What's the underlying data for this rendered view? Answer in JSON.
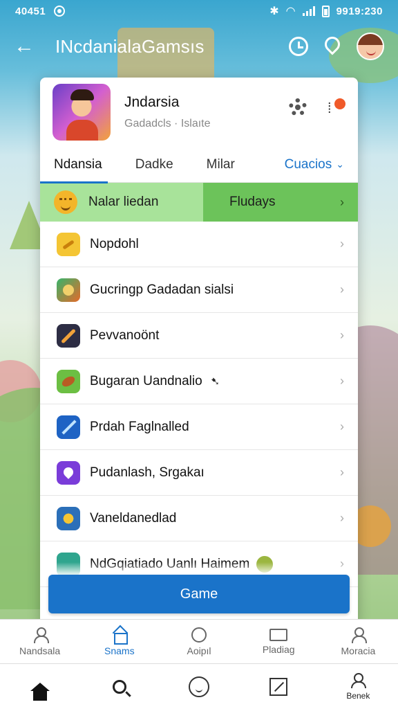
{
  "status_bar": {
    "left_text": "40451",
    "right_text": "9919:230"
  },
  "app_bar": {
    "title": "INcdanialaGamsıs"
  },
  "profile": {
    "name": "Jndarsia",
    "subtitle": "Gadadcls · Islaıte"
  },
  "tabs": [
    {
      "label": "Ndansia",
      "active": true
    },
    {
      "label": "Dadke",
      "active": false
    },
    {
      "label": "Milar",
      "active": false
    }
  ],
  "tab_dropdown": {
    "label": "Cuacios"
  },
  "highlight": {
    "label": "Nalar liedan",
    "value": "Fludays"
  },
  "list_items": [
    {
      "label": "Nopdohl",
      "icon": "bandage-icon"
    },
    {
      "label": "Gucringp Gadadan sialsi",
      "icon": "game-character-icon"
    },
    {
      "label": "Pevvanoönt",
      "icon": "sword-icon"
    },
    {
      "label": "Bugaran Uandnalio",
      "icon": "football-icon"
    },
    {
      "label": "Prdah Faglnalled",
      "icon": "arrow-launch-icon"
    },
    {
      "label": "Pudanlash, Srgakaı",
      "icon": "heart-app-icon"
    },
    {
      "label": "Vaneldanedlad",
      "icon": "puzzle-game-icon"
    },
    {
      "label": "NdGqiatiado Uanlı Haimem",
      "icon": "globe-app-icon"
    }
  ],
  "primary_button": {
    "label": "Game"
  },
  "bottom_nav": [
    {
      "label": "Nandsala",
      "icon": "user-icon",
      "active": false
    },
    {
      "label": "Snams",
      "icon": "home-icon",
      "active": true
    },
    {
      "label": "Aoipıl",
      "icon": "face-icon",
      "active": false
    },
    {
      "label": "Pladiag",
      "icon": "frame-icon",
      "active": false
    },
    {
      "label": "Moracia",
      "icon": "profile-icon",
      "active": false
    }
  ],
  "system_bar": {
    "last_label": "Benek"
  },
  "colors": {
    "accent": "#1a73c9",
    "highlight_light": "#a8e39a",
    "highlight_dark": "#6cc35a",
    "app_bar": "#3aa6cf"
  }
}
